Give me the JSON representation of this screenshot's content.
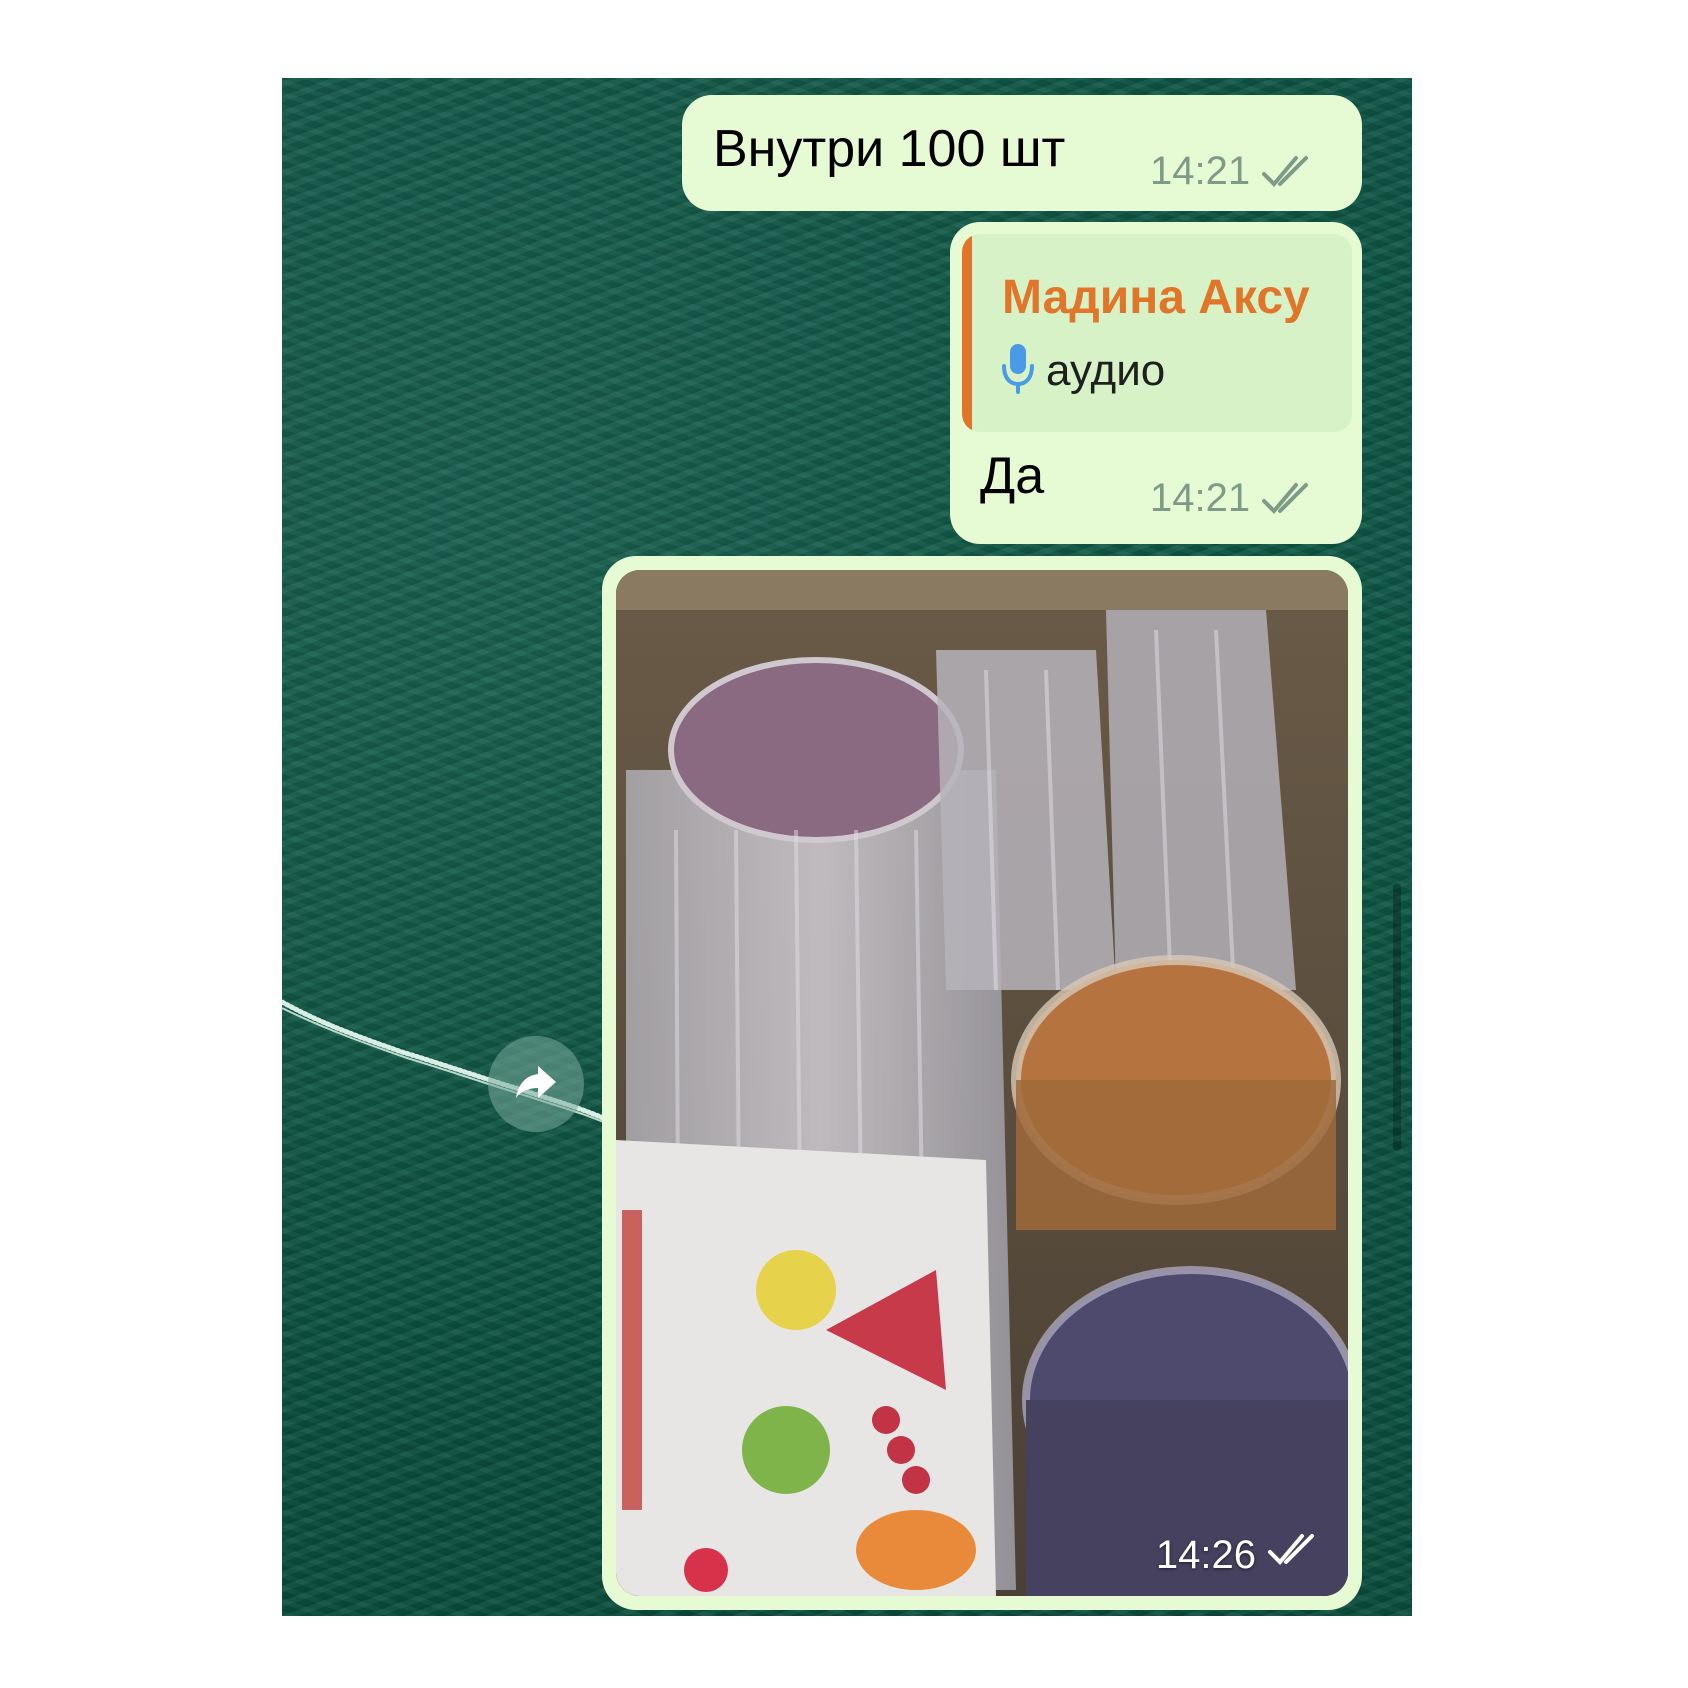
{
  "messages": [
    {
      "text": "Внутри 100 шт",
      "time": "14:21",
      "status_icon": "double-check-icon"
    },
    {
      "reply": {
        "author": "Мадина Аксу",
        "preview_icon": "microphone-icon",
        "preview_text": "аудио"
      },
      "text": "Да",
      "time": "14:21",
      "status_icon": "double-check-icon"
    },
    {
      "type": "photo",
      "time": "14:26",
      "status_icon": "double-check-icon"
    }
  ],
  "forward_icon": "forward-arrow-icon",
  "colors": {
    "chat_background": "#0f5746",
    "outgoing_bubble": "#e6fbd4",
    "reply_accent": "#e1762b",
    "reply_box": "#d6f2c6",
    "meta_text": "#7f9a86",
    "microphone": "#4a9be6"
  }
}
